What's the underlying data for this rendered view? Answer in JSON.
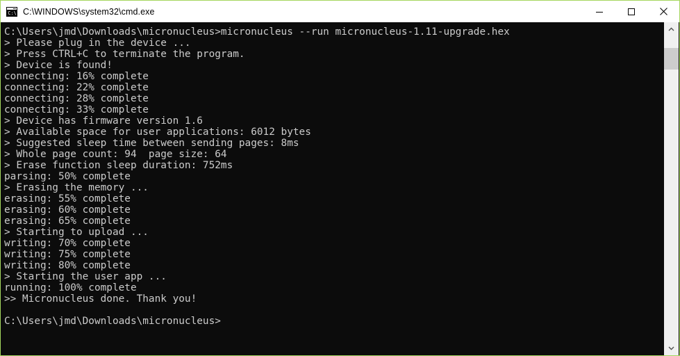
{
  "window": {
    "title": "C:\\WINDOWS\\system32\\cmd.exe",
    "icon": "cmd-console-icon",
    "border_color": "#a4d65e",
    "titlebar_bg": "#ffffff",
    "console_bg": "#0c0c0c",
    "console_fg": "#cccccc"
  },
  "controls": {
    "minimize_label": "Minimize",
    "maximize_label": "Maximize",
    "close_label": "Close"
  },
  "scrollbar": {
    "up_arrow_label": "Scroll up",
    "down_arrow_label": "Scroll down",
    "thumb_label": "Scroll thumb"
  },
  "console": {
    "lines": [
      "C:\\Users\\jmd\\Downloads\\micronucleus>micronucleus --run micronucleus-1.11-upgrade.hex",
      "> Please plug in the device ...",
      "> Press CTRL+C to terminate the program.",
      "> Device is found!",
      "connecting: 16% complete",
      "connecting: 22% complete",
      "connecting: 28% complete",
      "connecting: 33% complete",
      "> Device has firmware version 1.6",
      "> Available space for user applications: 6012 bytes",
      "> Suggested sleep time between sending pages: 8ms",
      "> Whole page count: 94  page size: 64",
      "> Erase function sleep duration: 752ms",
      "parsing: 50% complete",
      "> Erasing the memory ...",
      "erasing: 55% complete",
      "erasing: 60% complete",
      "erasing: 65% complete",
      "> Starting to upload ...",
      "writing: 70% complete",
      "writing: 75% complete",
      "writing: 80% complete",
      "> Starting the user app ...",
      "running: 100% complete",
      ">> Micronucleus done. Thank you!",
      "",
      "C:\\Users\\jmd\\Downloads\\micronucleus>"
    ]
  }
}
